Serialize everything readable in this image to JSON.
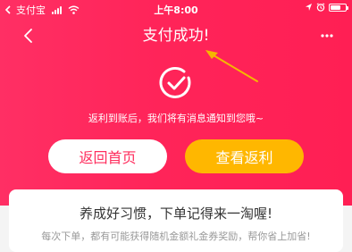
{
  "status_bar": {
    "carrier": "支付宝",
    "time": "上午8:00",
    "battery_level": 0.7
  },
  "nav": {
    "title": "支付成功!",
    "more_label": "···"
  },
  "success": {
    "message": "返利到账后，我们将有消息通知到您哦~"
  },
  "buttons": {
    "home": "返回首页",
    "rebate": "查看返利"
  },
  "card": {
    "title": "养成好习惯，下单记得来一淘喔!",
    "desc": "每次下单，都有可能获得随机金额礼金券奖励，帮你省上加省!"
  },
  "colors": {
    "hero": "#ff2459",
    "rebate_button": "#ffb700",
    "home_button_text": "#ff2d5d",
    "annotation_arrow": "#f5b800"
  }
}
